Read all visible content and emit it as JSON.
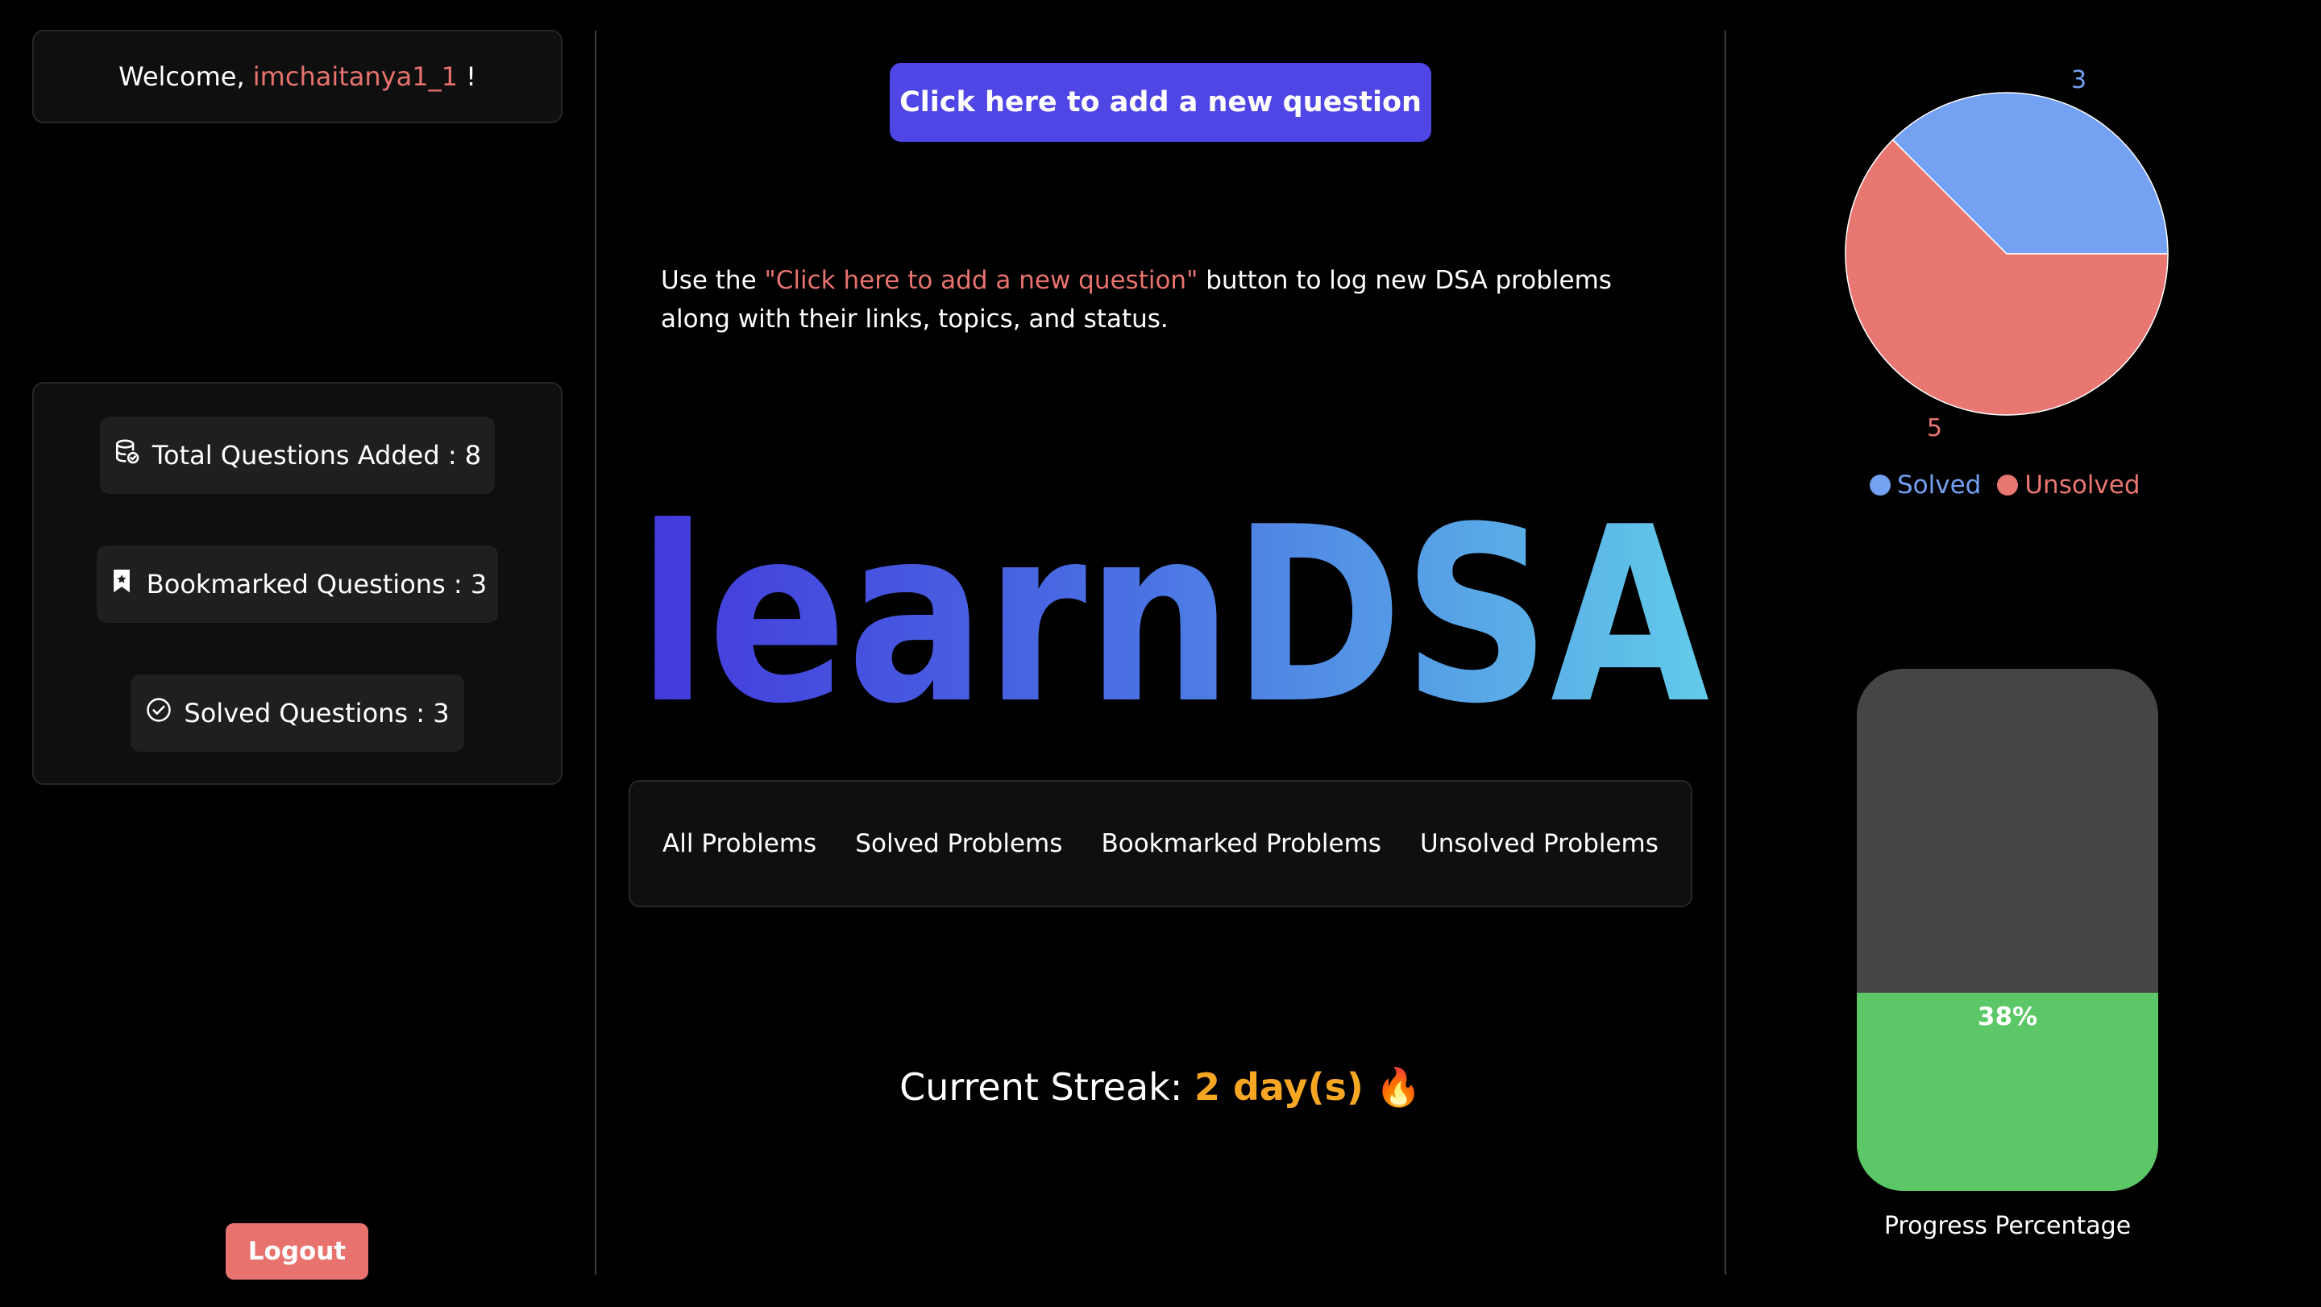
{
  "welcome": {
    "prefix": "Welcome,",
    "username": "imchaitanya1_1",
    "suffix": "!"
  },
  "stats": [
    {
      "icon": "database-icon",
      "label": "Total Questions Added : 8"
    },
    {
      "icon": "bookmark-icon",
      "label": "Bookmarked Questions : 3"
    },
    {
      "icon": "check-circle-icon",
      "label": "Solved Questions : 3"
    }
  ],
  "logout_label": "Logout",
  "add_button_label": "Click here to add a new question",
  "instructions": {
    "before": "Use the ",
    "highlight": "\"Click here to add a new question\"",
    "after": " button to log new DSA problems along with their links, topics, and status."
  },
  "logo_text": "learnDSA",
  "tabs": [
    "All Problems",
    "Solved Problems",
    "Bookmarked Problems",
    "Unsolved Problems"
  ],
  "streak": {
    "label": "Current Streak:",
    "value": "2 day(s)",
    "emoji": "🔥"
  },
  "chart_data": {
    "type": "pie",
    "categories": [
      "Solved",
      "Unsolved"
    ],
    "values": [
      3,
      5
    ],
    "colors": [
      "#74a1f2",
      "#e87671"
    ],
    "legend": "bottom"
  },
  "progress": {
    "value": 0.38,
    "label": "38%",
    "caption": "Progress Percentage",
    "fill_color": "#5cc766",
    "track_color": "#454545"
  },
  "colors": {
    "accent": "#4f46e5",
    "highlight": "#e8736e",
    "streak": "#f5a623"
  }
}
